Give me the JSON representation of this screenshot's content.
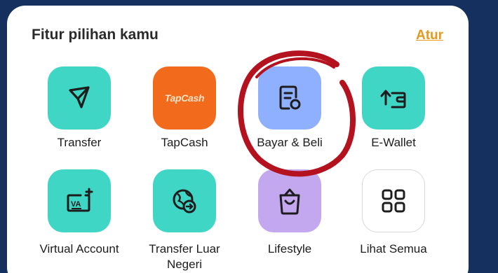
{
  "header": {
    "title": "Fitur pilihan kamu",
    "action_label": "Atur"
  },
  "features": [
    {
      "label": "Transfer",
      "icon": "send-icon",
      "color": "#3fd6c6"
    },
    {
      "label": "TapCash",
      "icon": "tapcash-logo",
      "color": "#f26a1b",
      "logo_text": "TapCash"
    },
    {
      "label": "Bayar & Beli",
      "icon": "receipt-icon",
      "color": "#8fb0ff"
    },
    {
      "label": "E-Wallet",
      "icon": "wallet-transfer-icon",
      "color": "#3fd6c6"
    },
    {
      "label": "Virtual Account",
      "icon": "virtual-account-icon",
      "color": "#3fd6c6",
      "badge_text": "VA"
    },
    {
      "label": "Transfer Luar Negeri",
      "label_line1": "Transfer Luar",
      "label_line2": "Negeri",
      "icon": "globe-transfer-icon",
      "color": "#3fd6c6"
    },
    {
      "label": "Lifestyle",
      "icon": "shopping-bag-icon",
      "color": "#c3a8f0"
    },
    {
      "label": "Lihat Semua",
      "icon": "grid-icon",
      "color": "#ffffff"
    }
  ],
  "accent_colors": {
    "background": "#15305e",
    "link": "#e39a1c",
    "highlight_ring": "#b3121e"
  }
}
